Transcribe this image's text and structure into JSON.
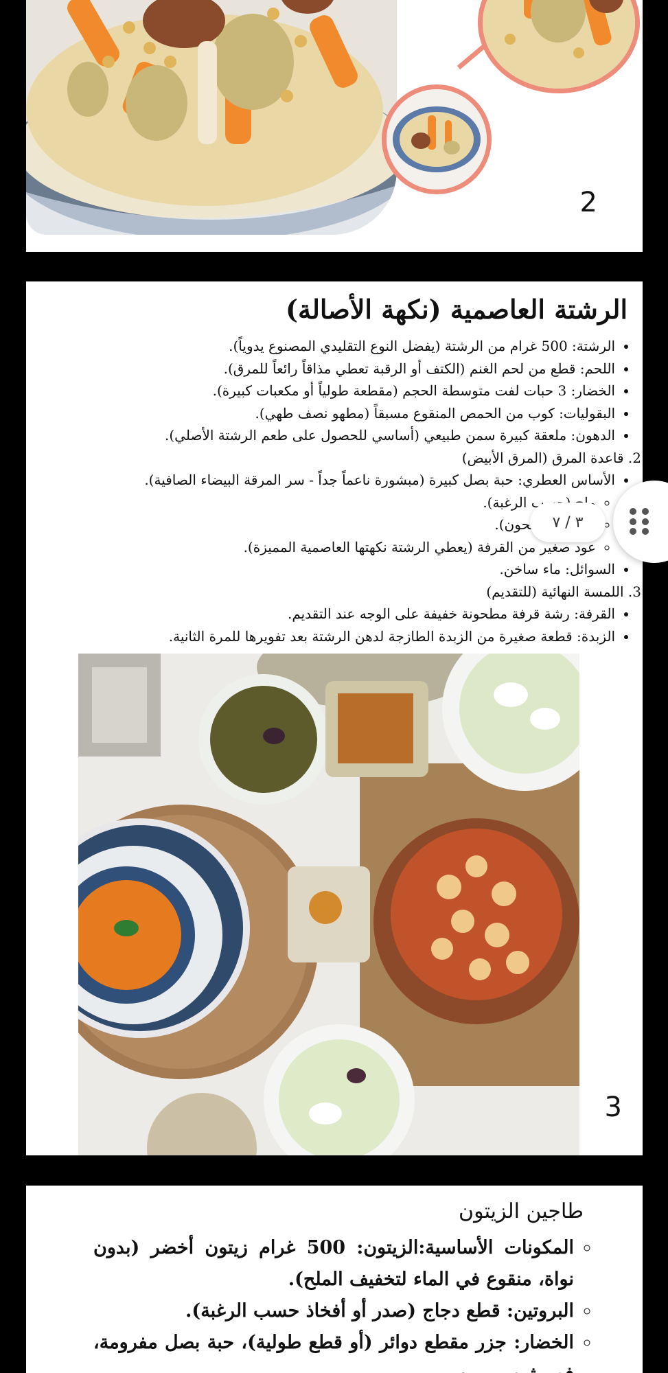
{
  "pages": [
    {
      "number": "2"
    },
    {
      "number": "3",
      "title": "الرشتة العاصمية (نكهة الأصالة)",
      "ingredients": [
        "الرشتة: 500 غرام من الرشتة (يفضل النوع التقليدي المصنوع يدوياً).",
        "اللحم: قطع من لحم الغنم (الكتف أو الرقبة تعطي مذاقاً رائعاً للمرق).",
        "الخضار: 3 حبات لفت متوسطة الحجم (مقطعة طولياً أو مكعبات كبيرة).",
        "البقوليات: كوب من الحمص المنقوع مسبقاً (مطهو نصف طهي).",
        "الدهون: ملعقة كبيرة سمن طبيعي (أساسي للحصول على طعم الرشتة الأصلي)."
      ],
      "section2": {
        "heading": "2. قاعدة المرق (المرق الأبيض)",
        "item": "الأساس العطري: حبة بصل كبيرة (مبشورة ناعماً جداً - سر المرقة البيضاء الصافية).",
        "subitems": [
          "ملح (حسب الرغبة).",
          "(طازج ومطحون).",
          "عود صغير من القرفة (يعطي الرشتة نكهتها العاصمية المميزة)."
        ],
        "liquids": "السوائل: ماء ساخن."
      },
      "section3": {
        "heading": "3. اللمسة النهائية (للتقديم)",
        "items": [
          "القرفة: رشة قرفة مطحونة خفيفة على الوجه عند التقديم.",
          "الزبدة: قطعة صغيرة من الزبدة الطازجة لدهن الرشتة بعد تفويرها للمرة الثانية."
        ]
      }
    },
    {
      "title": "طاجين الزيتون",
      "items": [
        "المكونات الأساسية:الزيتون: 500 غرام زيتون أخضر (بدون نواة، منقوع في الماء لتخفيف الملح).",
        "البروتين: قطع دجاج (صدر أو أفخاذ حسب الرغبة).",
        "الخضار: جزر مقطع دوائر (أو قطع طولية)، حبة بصل مفرومة، فص ثوم مهروس."
      ]
    }
  ],
  "page_indicator": "٣ / ٧",
  "accent_color": "#ee8c7b"
}
